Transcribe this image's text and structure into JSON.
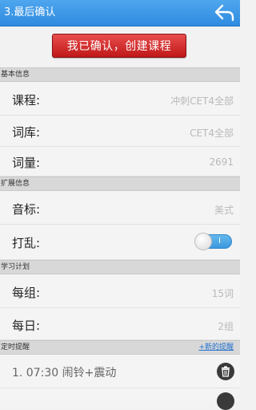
{
  "header": {
    "title": "3.最后确认",
    "back_icon": "back-arrow-icon"
  },
  "confirm_button": {
    "label": "我已确认，创建课程",
    "color": "#d42a2a"
  },
  "sections": {
    "basic": {
      "title": "基本信息",
      "course_label": "课程:",
      "course_value": "冲刺CET4全部",
      "lexicon_label": "词库:",
      "lexicon_value": "CET4全部",
      "count_label": "词量:",
      "count_value": "2691"
    },
    "extended": {
      "title": "扩展信息",
      "phonetic_label": "音标:",
      "phonetic_value": "美式",
      "shuffle_label": "打乱:",
      "shuffle_on": true,
      "shuffle_mark": "I"
    },
    "plan": {
      "title": "学习计划",
      "per_group_label": "每组:",
      "per_group_value": "15词",
      "per_day_label": "每日:",
      "per_day_value": "2组"
    },
    "reminder": {
      "title": "定时提醒",
      "add_link": "+新的提醒",
      "items": [
        {
          "label": "1.  07:30 闹铃+震动"
        }
      ]
    }
  },
  "colors": {
    "accent": "#2f8be0",
    "value_text": "#b9b9b9",
    "link": "#1f6fd0"
  }
}
